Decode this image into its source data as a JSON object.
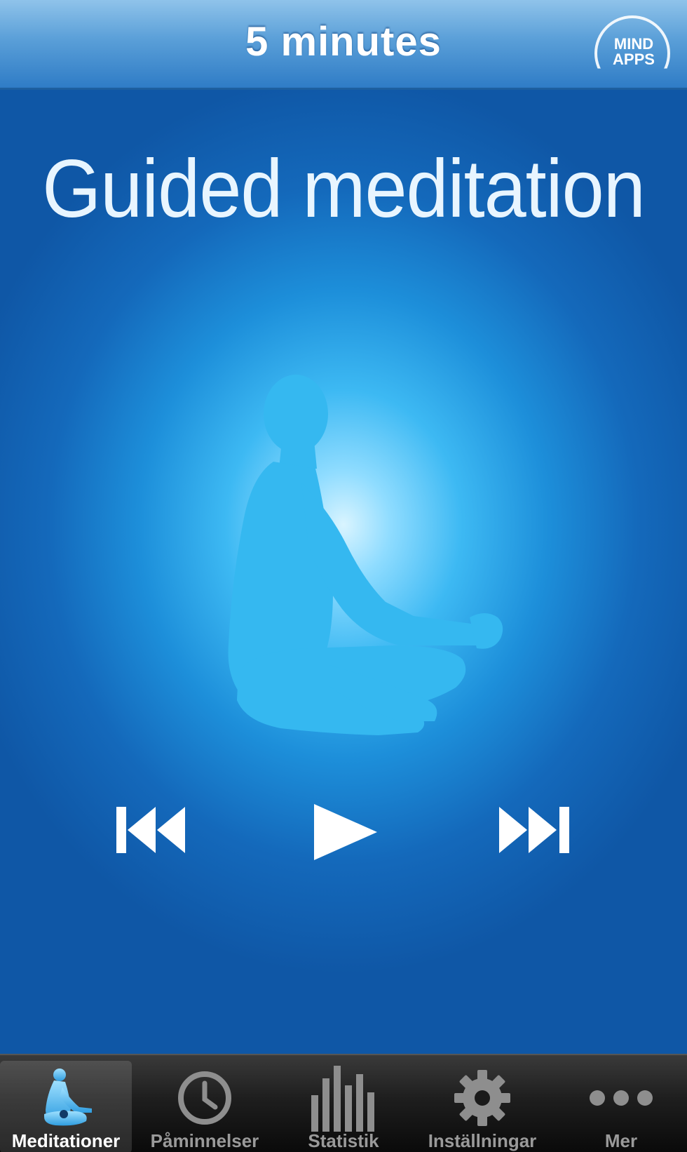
{
  "navbar": {
    "title": "5 minutes",
    "brand": {
      "line1": "MIND",
      "line2": "APPS",
      "icon": "mindapps-logo"
    }
  },
  "main": {
    "heading": "Guided meditation",
    "illustration": "meditating-person-silhouette",
    "controls": {
      "previous": {
        "icon": "skip-previous-icon"
      },
      "play": {
        "icon": "play-icon"
      },
      "next": {
        "icon": "skip-next-icon"
      }
    }
  },
  "tabbar": {
    "tabs": [
      {
        "label": "Meditationer",
        "icon": "meditation-icon",
        "active": true
      },
      {
        "label": "Påminnelser",
        "icon": "clock-icon",
        "active": false
      },
      {
        "label": "Statistik",
        "icon": "bar-chart-icon",
        "active": false
      },
      {
        "label": "Inställningar",
        "icon": "gear-icon",
        "active": false
      },
      {
        "label": "Mer",
        "icon": "more-dots-icon",
        "active": false
      }
    ]
  },
  "colors": {
    "accent": "#2f7cc6",
    "background": "#0f5fb2",
    "glow": "#d9f4ff",
    "silhouette": "#35b8f0",
    "tabbar": "#1e1e1e",
    "active_icon": "#5cc4ff"
  }
}
